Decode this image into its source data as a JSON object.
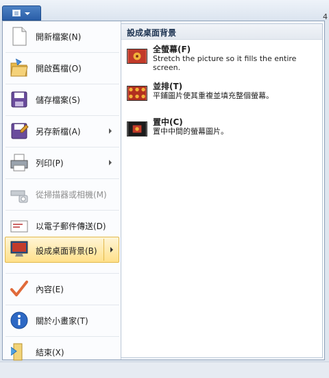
{
  "corner_char": "4",
  "menu": {
    "items": [
      {
        "label": "開新檔案(N)",
        "icon": "new-document-icon"
      },
      {
        "label": "開啟舊檔(O)",
        "icon": "open-folder-icon"
      },
      {
        "label": "儲存檔案(S)",
        "icon": "floppy-disk-icon"
      },
      {
        "label": "另存新檔(A)",
        "icon": "save-as-icon"
      },
      {
        "label": "列印(P)",
        "icon": "printer-icon"
      },
      {
        "label": "從掃描器或相機(M)",
        "icon": "scanner-camera-icon"
      },
      {
        "label": "以電子郵件傳送(D)",
        "icon": "email-icon"
      },
      {
        "label": "設成桌面背景(B)",
        "icon": "desktop-background-icon"
      },
      {
        "label": "內容(E)",
        "icon": "checkmark-icon"
      },
      {
        "label": "關於小畫家(T)",
        "icon": "info-icon"
      },
      {
        "label": "結束(X)",
        "icon": "exit-icon"
      }
    ]
  },
  "submenu": {
    "title": "設成桌面背景",
    "options": [
      {
        "title": "全螢幕(F)",
        "desc": "Stretch the picture so it fills the entire screen.",
        "icon": "fill-screen-icon"
      },
      {
        "title": "並排(T)",
        "desc": "平鋪圖片使其重複並填充整個螢幕。",
        "icon": "tile-icon"
      },
      {
        "title": "置中(C)",
        "desc": "置中中間的螢幕圖片。",
        "icon": "center-icon"
      }
    ]
  }
}
